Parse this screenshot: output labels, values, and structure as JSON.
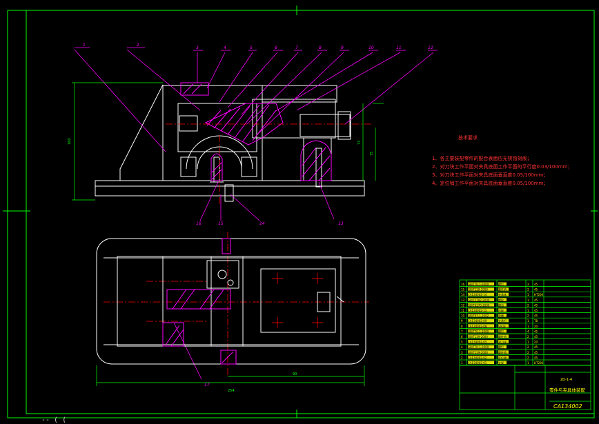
{
  "drawing": {
    "title_block_name": "CA134002",
    "title_block_part": "零件与夹具体装配",
    "title_block_drawing_no": "2D-1-4",
    "leader_labels": [
      "1",
      "2",
      "3",
      "4",
      "5",
      "6",
      "7",
      "8",
      "9",
      "10",
      "11",
      "12"
    ],
    "lower_leaders": [
      "16",
      "15",
      "14",
      "13",
      "17"
    ],
    "tech_req_title": "技术要求",
    "tech_req_lines": [
      "1、各主要装配零件的配合表面应无锈蚀刻痕；",
      "2、对刀块工作平面对夹具底面工作平面的平行度0.03/100mm；",
      "3、对刀块工作平面对夹具底面垂直度0.05/100mm；",
      "4、定位销工作平面对夹具底面垂直度0.05/100mm；"
    ],
    "dims": {
      "height": "160",
      "d1": "73",
      "d2": "75",
      "w_small": "90",
      "w_total": "254"
    },
    "bom_rows": [
      [
        "16",
        "GB/T70.1-2000",
        "螺钉",
        "2",
        "45"
      ],
      [
        "15",
        "GB/T119-2000",
        "圆柱销",
        "2",
        "45"
      ],
      [
        "14",
        "CA134002-14",
        "夹具体",
        "1",
        "HT200"
      ],
      [
        "13",
        "GB/T5782-2000",
        "螺栓",
        "1",
        "45"
      ],
      [
        "12",
        "GB/T6170-2000",
        "螺母",
        "2",
        "45"
      ],
      [
        "11",
        "CA134002-11",
        "压板",
        "1",
        "45"
      ],
      [
        "10",
        "GB/T97.1-2002",
        "垫圈",
        "2",
        "45"
      ],
      [
        "9",
        "CA134002-09",
        "支承钉",
        "1",
        "T8"
      ],
      [
        "8",
        "CA134002-08",
        "V形块",
        "1",
        "20"
      ],
      [
        "7",
        "GB/T70.1-2000",
        "螺钉",
        "4",
        "45"
      ],
      [
        "6",
        "GB/T119-2000",
        "圆柱销",
        "2",
        "45"
      ],
      [
        "5",
        "CA134002-05",
        "对刀块",
        "1",
        "20"
      ],
      [
        "4",
        "GB/T70.1-2000",
        "螺钉",
        "2",
        "45"
      ],
      [
        "3",
        "GB/T119-2000",
        "圆柱销",
        "2",
        "45"
      ],
      [
        "2",
        "CA134002-02",
        "定位键",
        "2",
        "45"
      ],
      [
        "1",
        "CA134002-01",
        "支架",
        "1",
        "HT200"
      ]
    ],
    "cursor_text": "-- ( (",
    "colors": {
      "frame": "#00ff00",
      "outline": "#ffffff",
      "leader": "#ff00ff",
      "center": "#ff0000",
      "hatch": "#ff00ff",
      "dim": "#00ff00",
      "table": "#00ff00",
      "table_fill": "#ffff00",
      "note": "#ff3333"
    }
  }
}
